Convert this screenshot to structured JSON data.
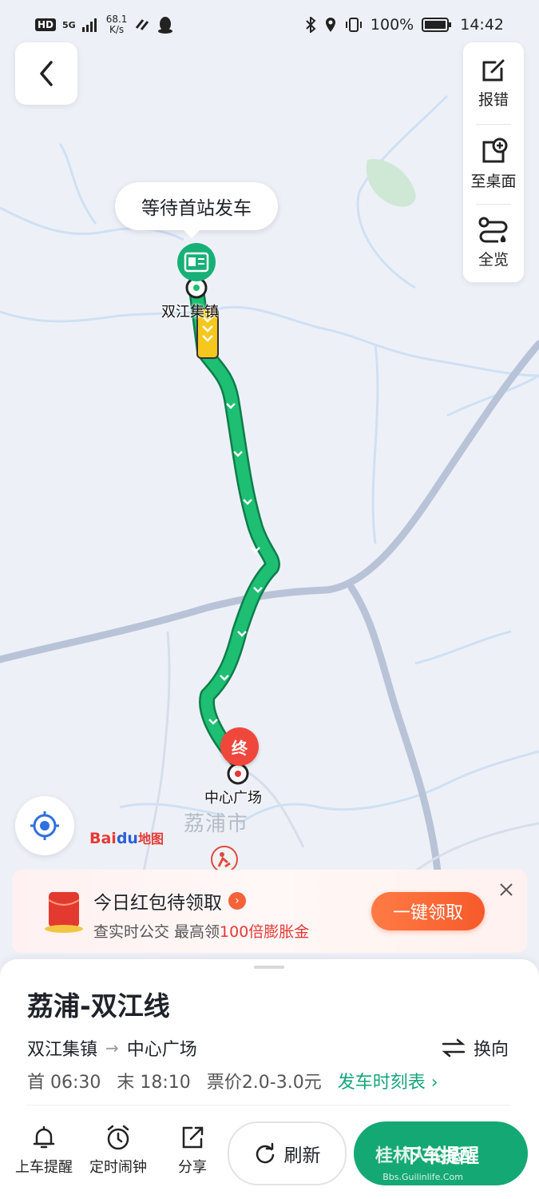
{
  "status_bar": {
    "network_badge": "HD",
    "signal": "5G",
    "speed_value": "68.1",
    "speed_unit": "K/s",
    "battery": "100%",
    "time": "14:42"
  },
  "map": {
    "tools": [
      {
        "label": "报错",
        "icon": "edit-icon"
      },
      {
        "label": "至桌面",
        "icon": "add-to-desktop-icon"
      },
      {
        "label": "全览",
        "icon": "overview-route-icon"
      }
    ],
    "bubble": "等待首站发车",
    "start_stop": "双江集镇",
    "end_stop": "中心广场",
    "end_marker": "终",
    "city": "荔浦市",
    "logo": {
      "bai": "Bai",
      "du": "du",
      "map": "地图"
    }
  },
  "promo": {
    "title": "今日红包待领取",
    "sub_prefix": "查实时公交 最高领",
    "sub_highlight": "100倍膨胀金",
    "cta": "一键领取"
  },
  "sheet": {
    "line_name": "荔浦-双江线",
    "from": "双江集镇",
    "to": "中心广场",
    "reverse": "换向",
    "first": "首 06:30",
    "last": "末 18:10",
    "fare": "票价2.0-3.0元",
    "schedule_link": "发车时刻表",
    "actions": [
      {
        "label": "上车提醒",
        "icon": "bell-icon"
      },
      {
        "label": "定时闹钟",
        "icon": "alarm-clock-icon"
      },
      {
        "label": "分享",
        "icon": "share-icon"
      }
    ],
    "refresh": "刷新",
    "remind": "下车提醒"
  },
  "watermark": {
    "text": "桂林人论坛",
    "site": "Bbs.Guilinlife.Com"
  },
  "colors": {
    "route": "#1aaa66",
    "accent": "#14a874",
    "promo_red": "#e53935",
    "river": "#cfe0f4",
    "road": "#b9c3d8"
  }
}
